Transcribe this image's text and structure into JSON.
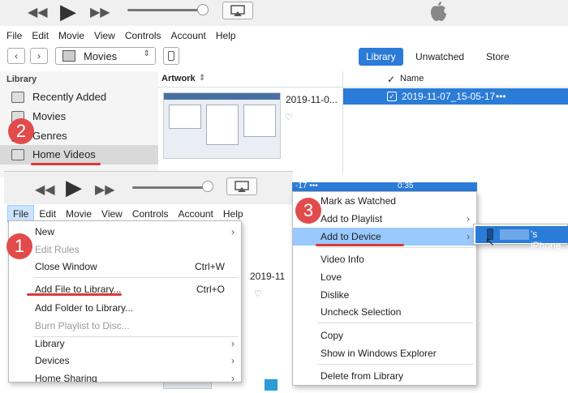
{
  "top_menu": [
    "File",
    "Edit",
    "Movie",
    "View",
    "Controls",
    "Account",
    "Help"
  ],
  "media_select": "Movies",
  "tabs": {
    "library": "Library",
    "unwatched": "Unwatched",
    "store": "Store"
  },
  "sidebar": {
    "heading": "Library",
    "items": [
      "Recently Added",
      "Movies",
      "Genres",
      "Home Videos"
    ]
  },
  "list_header": {
    "artwork": "Artwork",
    "check": "✓",
    "name": "Name"
  },
  "row": {
    "date_short": "2019-11-0...",
    "name": "2019-11-07_15-05-17",
    "dots": "•••",
    "snippet": "-17 •••",
    "time": "0:35"
  },
  "inset_menu": [
    "File",
    "Edit",
    "Movie",
    "View",
    "Controls",
    "Account",
    "Help"
  ],
  "file_menu": [
    {
      "label": "New",
      "sub": true
    },
    {
      "label": "Edit Rules",
      "disabled": true
    },
    {
      "label": "Close Window",
      "shortcut": "Ctrl+W"
    },
    {
      "label": "Add File to Library...",
      "shortcut": "Ctrl+O"
    },
    {
      "label": "Add Folder to Library..."
    },
    {
      "label": "Burn Playlist to Disc...",
      "disabled": true
    },
    {
      "label": "Library",
      "sub": true
    },
    {
      "label": "Devices",
      "sub": true
    },
    {
      "label": "Home Sharing",
      "sub": true
    }
  ],
  "context_menu": [
    "Mark as Watched",
    "Add to Playlist",
    "Add to Device",
    "Video Info",
    "Love",
    "Dislike",
    "Uncheck Selection",
    "Copy",
    "Show in Windows Explorer",
    "Delete from Library"
  ],
  "device_submenu": "'s iPhone",
  "behind_row_date": "2019-11",
  "badges": [
    "1",
    "2",
    "3"
  ],
  "colors": {
    "accent": "#2b7bd8",
    "badge": "#e24b4b",
    "underline": "#d83a3a",
    "highlight": "#cce4ff"
  }
}
